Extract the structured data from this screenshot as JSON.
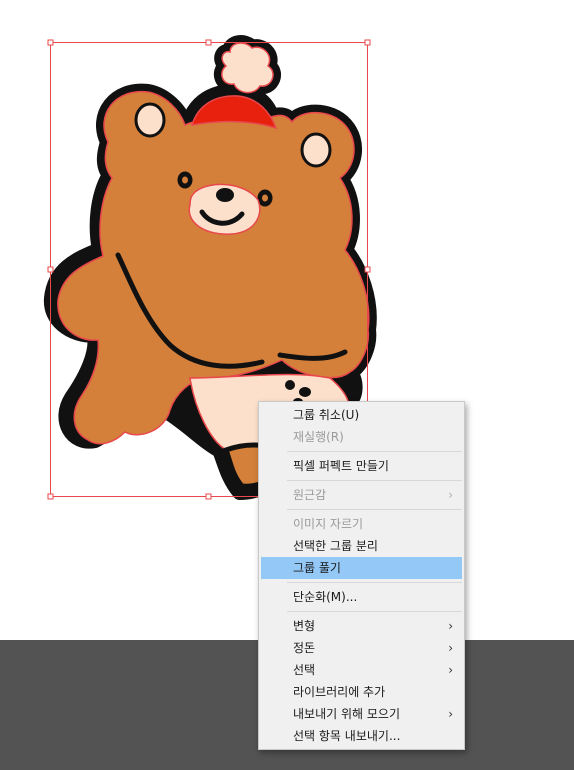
{
  "menu": {
    "items": [
      {
        "id": "ungroup",
        "label": "그룹 취소(U)",
        "enabled": true
      },
      {
        "id": "redo",
        "label": "재실행(R)",
        "enabled": false
      },
      {
        "sep": true
      },
      {
        "id": "pixel-perfect",
        "label": "픽셀 퍼펙트 만들기",
        "enabled": true
      },
      {
        "sep": true
      },
      {
        "id": "perspective",
        "label": "원근감",
        "enabled": false,
        "submenu": true
      },
      {
        "sep": true
      },
      {
        "id": "crop-image",
        "label": "이미지 자르기",
        "enabled": false
      },
      {
        "id": "release-selected-group",
        "label": "선택한 그룹 분리",
        "enabled": true
      },
      {
        "id": "group-isolate",
        "label": "그룹 풀기",
        "enabled": true,
        "highlighted": true
      },
      {
        "sep": true
      },
      {
        "id": "simplify",
        "label": "단순화(M)...",
        "enabled": true
      },
      {
        "sep": true
      },
      {
        "id": "transform",
        "label": "변형",
        "enabled": true,
        "submenu": true
      },
      {
        "id": "arrange",
        "label": "정돈",
        "enabled": true,
        "submenu": true
      },
      {
        "id": "select",
        "label": "선택",
        "enabled": true,
        "submenu": true
      },
      {
        "id": "add-to-library",
        "label": "라이브러리에 추가",
        "enabled": true
      },
      {
        "id": "collect-for-export",
        "label": "내보내기 위해 모으기",
        "enabled": true,
        "submenu": true
      },
      {
        "id": "export-selection",
        "label": "선택 항목 내보내기...",
        "enabled": true
      }
    ],
    "submenu_arrow": "›"
  },
  "colors": {
    "bear_fur": "#d4803a",
    "bear_outline": "#111111",
    "path_highlight": "#e8474b",
    "hat_red": "#e8200e",
    "pompom": "#fde0cc",
    "menu_highlight": "#94c8f7",
    "pasteboard": "#535353"
  },
  "icons": [
    "submenu-arrow-icon"
  ]
}
